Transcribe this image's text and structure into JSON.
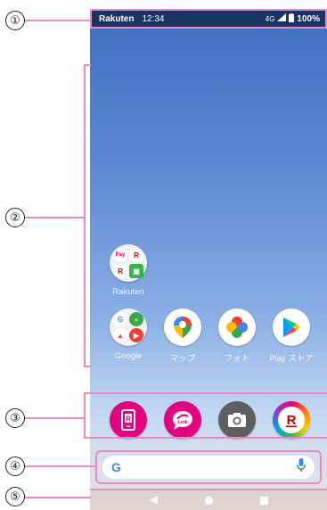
{
  "callouts": [
    "①",
    "②",
    "③",
    "④",
    "⑤"
  ],
  "status_bar": {
    "carrier": "Rakuten",
    "time": "12:34",
    "network": "4G",
    "battery": "100%"
  },
  "home_apps": [
    {
      "label": "Rakuten",
      "icon": "rakuten-folder-icon"
    },
    {
      "label": "Google",
      "icon": "google-folder-icon"
    },
    {
      "label": "マップ",
      "icon": "maps-icon"
    },
    {
      "label": "フォト",
      "icon": "photos-icon"
    },
    {
      "label": "Play ストア",
      "icon": "play-store-icon"
    }
  ],
  "dock_apps": [
    {
      "name": "my-rakuten-mobile",
      "icon": "my-rakuten-icon",
      "color": "#e4007f"
    },
    {
      "name": "rakuten-link",
      "icon": "rakuten-link-icon",
      "color": "#e4007f"
    },
    {
      "name": "camera",
      "icon": "camera-icon",
      "color": "#5f5f5f"
    },
    {
      "name": "rakuten-r",
      "icon": "rakuten-r-icon",
      "color": "#bf0000"
    }
  ],
  "search": {
    "logo": "G",
    "mic_icon": "mic-icon"
  },
  "nav": [
    "back-icon",
    "home-icon",
    "recents-icon"
  ],
  "colors": {
    "annotation": "#e98ac4",
    "rakuten_pink": "#e4007f",
    "status_bar": "#1c3461"
  }
}
